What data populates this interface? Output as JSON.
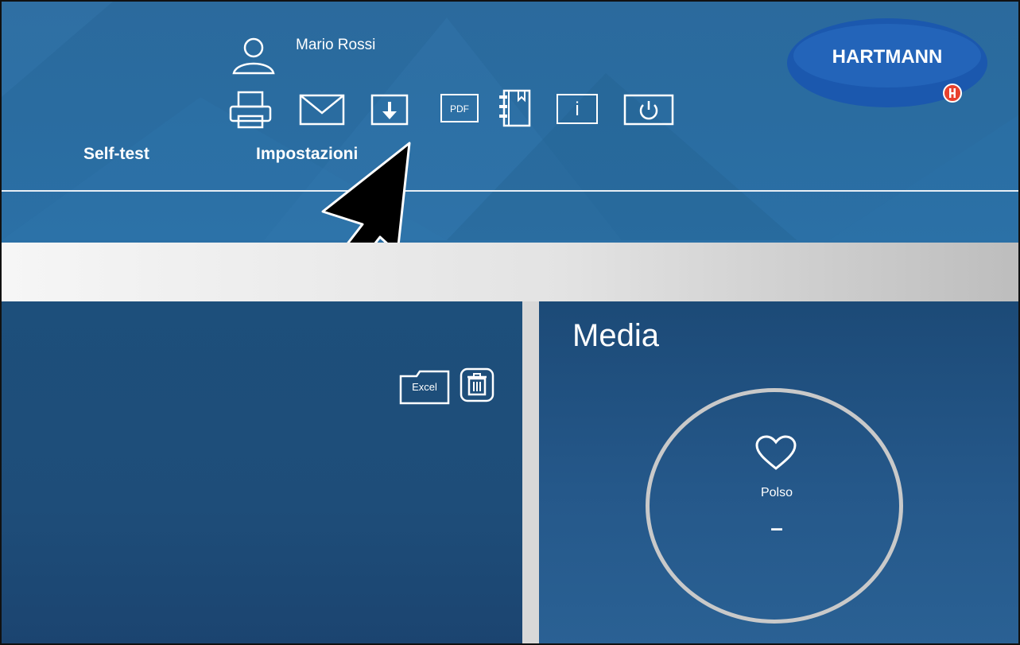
{
  "user": {
    "name": "Mario Rossi",
    "icon": "user-icon"
  },
  "toolbar": {
    "items": [
      {
        "icon": "printer-icon"
      },
      {
        "icon": "mail-icon"
      },
      {
        "icon": "download-icon"
      },
      {
        "icon": "pdf-icon",
        "label": "PDF"
      },
      {
        "icon": "notebook-icon"
      },
      {
        "icon": "info-icon",
        "label": "i"
      },
      {
        "icon": "power-icon"
      }
    ]
  },
  "nav": {
    "selftest": "Self-test",
    "settings": "Impostazioni"
  },
  "logo": {
    "text": "HARTMANN"
  },
  "left_panel": {
    "excel_label": "Excel"
  },
  "media": {
    "title": "Media",
    "pulse_label": "Polso",
    "pulse_value": "–"
  },
  "colors": {
    "header_blue": "#2b6a9d",
    "panel_blue": "#1d4f7b",
    "logo_blue": "#1a58b0",
    "logo_badge": "#e8412e"
  }
}
